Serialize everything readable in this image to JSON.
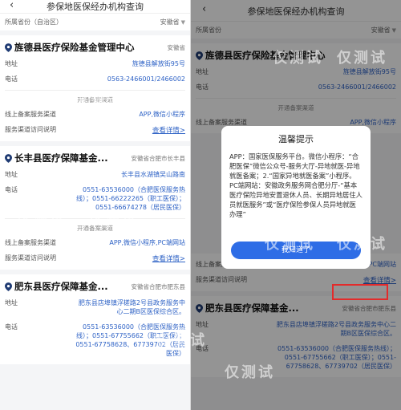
{
  "left": {
    "title": "参保地医保经办机构查询",
    "filter_left": "所属省份（自治区）",
    "filter_right": "安徽省",
    "cards": [
      {
        "name": "旌德县医疗保险基金管理中心",
        "region": "安徽省",
        "address_label": "地址",
        "address": "旌德县解放街95号",
        "phone_label": "电话",
        "phone": "0563-2466001/2466002",
        "channels_header": "开通备案渠道",
        "online_label": "线上备案服务渠道",
        "online_value": "APP,微信小程序",
        "desc_label": "服务渠道访问说明",
        "detail": "查看详情>"
      },
      {
        "name": "长丰县医疗保障基金...",
        "region": "安徽省合肥市长丰县",
        "address_label": "地址",
        "address": "长丰县水湖镇吴山路南",
        "phone_label": "电话",
        "phone": "0551-63536000（合肥医保服务热线）；0551-66222265（职工医保）；0551-66674278（居民医保）",
        "channels_header": "开通备案渠道",
        "online_label": "线上备案服务渠道",
        "online_value": "APP,微信小程序,PC端网站",
        "desc_label": "服务渠道访问说明",
        "detail": "查看详情>"
      },
      {
        "name": "肥东县医疗保障基金...",
        "region": "安徽省合肥市肥东县",
        "address_label": "地址",
        "address": "肥东县店埠镇浮槎路2号县政务服务中心二期B区医保综合区。",
        "phone_label": "电话",
        "phone": "0551-63536000（合肥医保服务热线）；0551-67755662（职工医保）；0551-67758628、67739702（居民医保）"
      }
    ]
  },
  "right": {
    "title": "参保地医保经办机构查询",
    "filter_left": "所属省份",
    "filter_right": "安徽省",
    "modal": {
      "title": "温馨提示",
      "body": "APP：国家医保服务平台。微信小程序：“合肥医保”微信公众号-服务大厅-异地就医-异地就医备案；2.“国家异地就医备案”小程序。PC端网站：安徽政务服务网合肥分厅-“基本医疗保险异地安置退休人员、长期异地居住人员就医服务”或“医疗保险参保人员异地就医办理”",
      "button": "我知道了"
    },
    "highlight_detail": "查看详情>"
  },
  "watermark": "仅测试"
}
